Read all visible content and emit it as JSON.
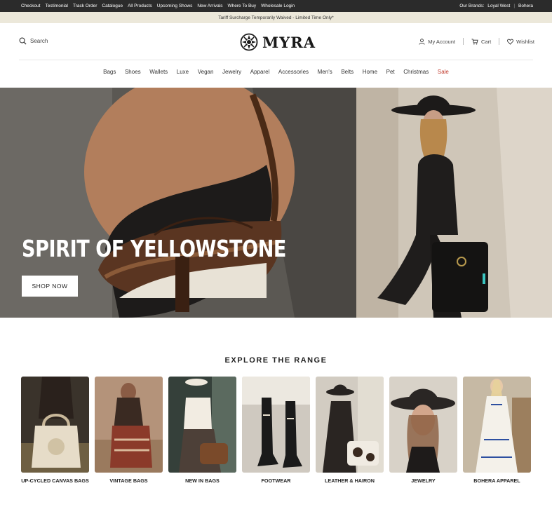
{
  "util_bar": {
    "links": [
      "Checkout",
      "Testimonial",
      "Track Order",
      "Catalogue",
      "All Products",
      "Upcoming Shows",
      "New Arrivals",
      "Where To Buy",
      "Wholesale Login"
    ],
    "brands_label": "Our Brands:",
    "brands": [
      "Loyal West",
      "Bohera"
    ],
    "separator": "|"
  },
  "promo": {
    "text": "Tariff Surcharge Temporarily Waived - Limited Time Only*"
  },
  "header": {
    "search_label": "Search",
    "logo_text": "MYRA",
    "account_label": "My Account",
    "cart_label": "Cart",
    "wishlist_label": "Wishlist"
  },
  "nav": {
    "items": [
      "Bags",
      "Shoes",
      "Wallets",
      "Luxe",
      "Vegan",
      "Jewelry",
      "Apparel",
      "Accessories",
      "Men's",
      "Belts",
      "Home",
      "Pet",
      "Christmas",
      "Sale"
    ]
  },
  "hero": {
    "title": "SPIRIT OF YELLOWSTONE",
    "button_label": "SHOP NOW"
  },
  "explore": {
    "title": "EXPLORE THE RANGE",
    "categories": [
      {
        "label": "UP-CYCLED CANVAS BAGS"
      },
      {
        "label": "VINTAGE BAGS"
      },
      {
        "label": "NEW IN BAGS"
      },
      {
        "label": "FOOTWEAR"
      },
      {
        "label": "LEATHER & HAIRON"
      },
      {
        "label": "JEWELRY"
      },
      {
        "label": "BOHERA APPAREL"
      }
    ]
  },
  "colors": {
    "util_bg": "#2b2b2b",
    "promo_bg": "#ece8da",
    "sale": "#c0392b"
  }
}
